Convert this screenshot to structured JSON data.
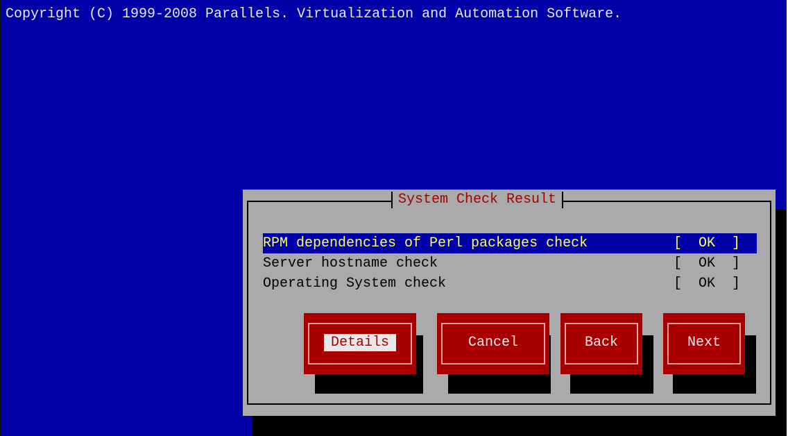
{
  "header": {
    "copyright": "Copyright (C) 1999-2008 Parallels. Virtualization and Automation Software."
  },
  "dialog": {
    "title": "System Check Result",
    "checks": [
      {
        "name": "RPM dependencies of Perl packages check",
        "status": "[  OK  ]",
        "selected": true
      },
      {
        "name": "Server hostname check",
        "status": "[  OK  ]",
        "selected": false
      },
      {
        "name": "Operating System check",
        "status": "[  OK  ]",
        "selected": false
      }
    ],
    "buttons": {
      "details": "Details",
      "cancel": "Cancel",
      "back": "Back",
      "next": "Next"
    }
  },
  "colors": {
    "screen_background": "#0000a8",
    "dialog_background": "#aaaaaa",
    "button_background": "#a80000",
    "title_text": "#a80000",
    "selected_row_background": "#0000a8",
    "selected_row_text": "#ffff55"
  }
}
